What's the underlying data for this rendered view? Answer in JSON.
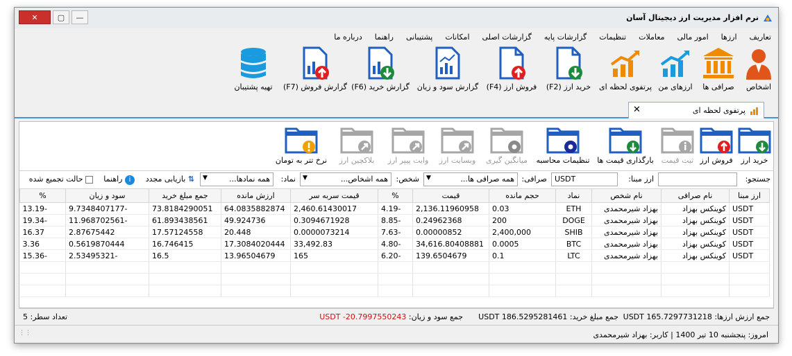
{
  "window": {
    "title": "نرم افزار مدیریت ارز دیجیتال آسان",
    "close_label": "✕",
    "max_label": "▢",
    "min_label": "—"
  },
  "menu": [
    "تعاریف",
    "ارزها",
    "امور مالی",
    "معاملات",
    "تنظیمات",
    "گزارشات پایه",
    "گزارشات اصلی",
    "امکانات",
    "پشتیبانی",
    "راهنما",
    "درباره ما"
  ],
  "ribbon": {
    "persons": "اشخاص",
    "exchanges": "صرافی ها",
    "my_coins": "ارزهای من",
    "portfolio": "پرتفوی لحظه ای",
    "buy": "خرید ارز (F2)",
    "sell": "فروش ارز (F4)",
    "profit_report": "گزارش سود و زیان",
    "buy_report": "گزارش خرید (F6)",
    "sell_report": "گزارش فروش (F7)",
    "backup": "تهیه پشتیبان"
  },
  "tab": {
    "label": "پرتفوی لحظه ای",
    "close": "✕"
  },
  "toolbar": {
    "buy": "خرید ارز",
    "sell": "فروش ارز",
    "register_price": "ثبت قیمت",
    "load_prices": "بارگذاری قیمت ها",
    "accounting_settings": "تنظیمات محاسبه",
    "averaging": "میانگین گیری",
    "website": "وبسایت ارز",
    "whitepaper": "وایت پیپر ارز",
    "blockchain": "بلاکچین ارز",
    "tether_rate": "نرخ تتر به تومان"
  },
  "filters": {
    "search_label": "جستجو:",
    "search_value": "",
    "base_label": "ارز مبنا:",
    "base_value": "USDT",
    "exchange_label": "صرافی:",
    "exchange_value": "همه صرافی ها...",
    "person_label": "شخص:",
    "person_value": "همه اشخاص...",
    "symbol_label": "نماد:",
    "symbol_value": "همه نمادها...",
    "refresh_label": "بازیابی مجدد",
    "help_label": "راهنما",
    "aggregate_label": "حالت تجمیع شده"
  },
  "table": {
    "columns": [
      "ارز مبنا",
      "نام صرافی",
      "نام شخص",
      "نماد",
      "حجم مانده",
      "قیمت",
      "%",
      "قیمت سربه سر",
      "ارزش مانده",
      "جمع مبلغ خرید",
      "سود و زیان",
      "%"
    ],
    "rows": [
      [
        "USDT",
        "کوینکس بهزاد",
        "بهزاد شیرمحمدی",
        "ETH",
        "0.03",
        "2,136.11960958",
        "-4.19",
        "2,460.61430017",
        "64.0835882874",
        "73.8184290051",
        "-9.7348407177",
        "-13.19"
      ],
      [
        "USDT",
        "کوینکس بهزاد",
        "بهزاد شیرمحمدی",
        "DOGE",
        "200",
        "0.24962368",
        "-8.85",
        "0.3094671928",
        "49.924736",
        "61.893438561",
        "-11.968702561",
        "-19.34"
      ],
      [
        "USDT",
        "کوینکس بهزاد",
        "بهزاد شیرمحمدی",
        "SHIB",
        "2,400,000",
        "0.00000852",
        "-7.63",
        "0.0000073214",
        "20.448",
        "17.57124558",
        "2.87675442",
        "16.37"
      ],
      [
        "USDT",
        "کوینکس بهزاد",
        "بهزاد شیرمحمدی",
        "BTC",
        "0.0005",
        "34,616.80408881",
        "-4.80",
        "33,492.83",
        "17.3084020444",
        "16.746415",
        "0.5619870444",
        "3.36"
      ],
      [
        "USDT",
        "کوینکس بهزاد",
        "بهزاد شیرمحمدی",
        "LTC",
        "0.1",
        "139.6504679",
        "-6.20",
        "165",
        "13.96504679",
        "16.5",
        "-2.53495321",
        "-15.36"
      ]
    ]
  },
  "summary": {
    "total_value": "جمع ارزش ارزها: USDT 165.7297731218",
    "total_buy": "جمع مبلغ خرید: USDT 186.5295281461",
    "total_profit_label": "جمع سود و زیان:",
    "total_profit_value": "USDT -20.7997550243",
    "row_count": "تعداد سطر: 5"
  },
  "status": {
    "text": "امروز: پنجشنبه 10 تیر 1400  |  کاربر: بهزاد شیرمحمدی"
  },
  "colors": {
    "accent": "#4a90d9",
    "folder": "#1f5fbf",
    "loss": "#cc1111"
  }
}
